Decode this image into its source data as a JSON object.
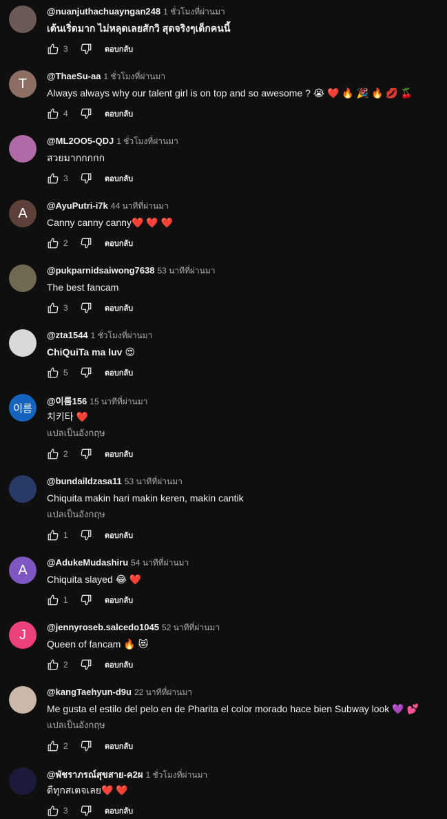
{
  "reply_label": "ตอบกลับ",
  "translate_label": "แปลเป็นอังกฤษ",
  "icons": {
    "like": "thumbs-up-icon",
    "dislike": "thumbs-down-icon"
  },
  "comments": [
    {
      "handle": "@nuanjuthachuayngan248",
      "time": "1 ชั่วโมงที่ผ่านมา",
      "text": "เต้นเริ่ดมาก ไม่หลุดเลยสักวิ สุดจริงๆเด็กคนนี้",
      "likes": "3",
      "avatar_letter": "",
      "avatar_color": "#6b5a55"
    },
    {
      "handle": "@ThaeSu-aa",
      "time": "1 ชั่วโมงที่ผ่านมา",
      "text": "Always always why our talent girl is on top and so awesome ? 😭 ❤️ 🔥 🎉 🔥 💋 🍒",
      "likes": "4",
      "avatar_letter": "T",
      "avatar_color": "#8d6e63"
    },
    {
      "handle": "@ML2OO5-QDJ",
      "time": "1 ชั่วโมงที่ผ่านมา",
      "text": "สวยมากกกกก",
      "likes": "3",
      "avatar_letter": "",
      "avatar_color": "#b06aa8"
    },
    {
      "handle": "@AyuPutri-i7k",
      "time": "44 นาทีที่ผ่านมา",
      "text": "Canny canny canny❤️ ❤️ ❤️",
      "likes": "2",
      "avatar_letter": "A",
      "avatar_color": "#5d4037"
    },
    {
      "handle": "@pukparnidsaiwong7638",
      "time": "53 นาทีที่ผ่านมา",
      "text": "The best fancam",
      "likes": "3",
      "avatar_letter": "",
      "avatar_color": "#6e6a52"
    },
    {
      "handle": "@zta1544",
      "time": "1 ชั่วโมงที่ผ่านมา",
      "text": "ChiQuiTa ma luv 😍",
      "likes": "5",
      "avatar_letter": "",
      "avatar_color": "#d9d9d9"
    },
    {
      "handle": "@이름156",
      "time": "15 นาทีที่ผ่านมา",
      "text": "치키타 ❤️",
      "likes": "2",
      "avatar_letter": "이름",
      "avatar_color": "#1565c0",
      "translate": true
    },
    {
      "handle": "@bundaildzasa11",
      "time": "53 นาทีที่ผ่านมา",
      "text": "Chiquita makin hari makin keren, makin cantik",
      "likes": "1",
      "avatar_letter": "",
      "avatar_color": "#2a3a66",
      "translate": true
    },
    {
      "handle": "@AdukeMudashiru",
      "time": "54 นาทีที่ผ่านมา",
      "text": "Chiquita slayed 😂 ❤️",
      "likes": "1",
      "avatar_letter": "A",
      "avatar_color": "#7e57c2"
    },
    {
      "handle": "@jennyroseb.salcedo1045",
      "time": "52 นาทีที่ผ่านมา",
      "text": "Queen of fancam 🔥 😻",
      "likes": "2",
      "avatar_letter": "J",
      "avatar_color": "#ec407a"
    },
    {
      "handle": "@kangTaehyun-d9u",
      "time": "22 นาทีที่ผ่านมา",
      "text": "Me gusta el estilo del pelo en de Pharita el color morado hace bien Subway look 💜 💕",
      "likes": "2",
      "avatar_letter": "",
      "avatar_color": "#c9b8a8",
      "translate": true
    },
    {
      "handle": "@พัชราภรณ์สุขสาย-ค2ผ",
      "time": "1 ชั่วโมงที่ผ่านมา",
      "text": "ดีทุกสเตจเลย❤️ ❤️",
      "likes": "3",
      "avatar_letter": "",
      "avatar_color": "#1a1a3a"
    }
  ]
}
